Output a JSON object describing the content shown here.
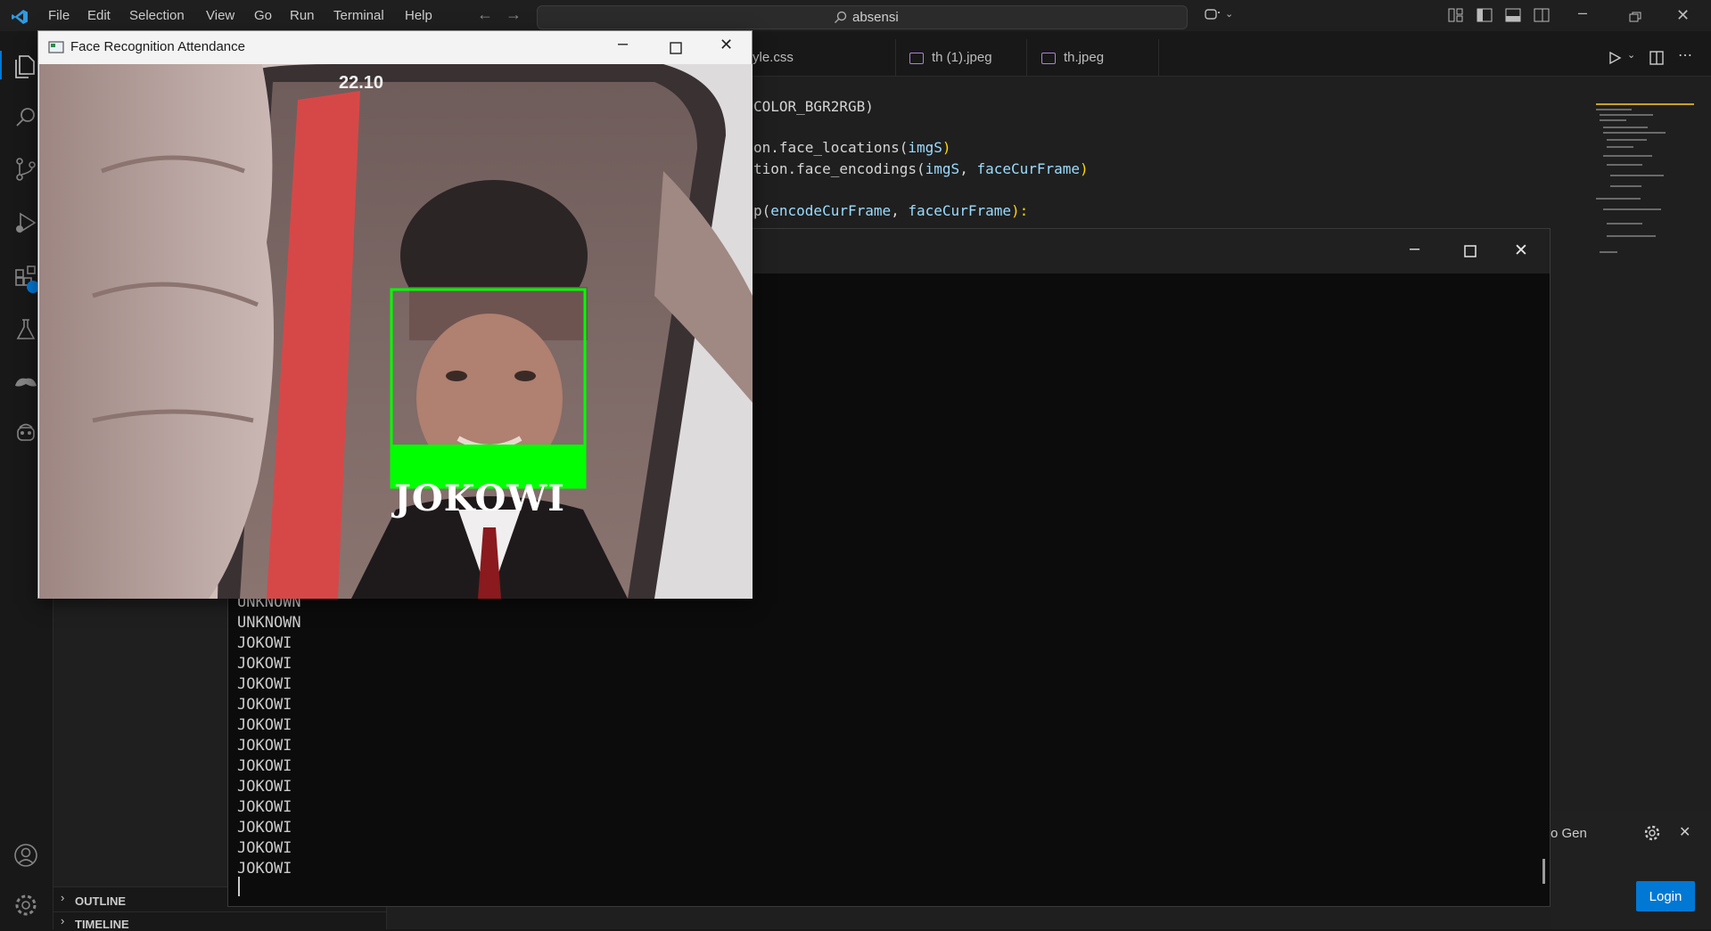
{
  "menu": [
    "File",
    "Edit",
    "Selection",
    "View",
    "Go",
    "Run",
    "Terminal",
    "Help"
  ],
  "command_center": {
    "text": "absensi"
  },
  "tabs": [
    {
      "label": "yle.css"
    },
    {
      "label": "th (1).jpeg"
    },
    {
      "label": "th.jpeg"
    }
  ],
  "code": {
    "line1": "COLOR_BGR2RGB)",
    "line2a": "on.face_locations(",
    "line2b": "imgS",
    "line2c": ")",
    "line3a": "tion.face_encodings(",
    "line3b": "imgS",
    "line3c": ", ",
    "line3d": "faceCurFrame",
    "line3e": ")",
    "line4a": "p(",
    "line4b": "encodeCurFrame",
    "line4c": ", ",
    "line4d": "faceCurFrame",
    "line4e": "):"
  },
  "face_window": {
    "title": "Face Recognition Attendance",
    "overlay_label": "JOKOWI",
    "box_color": "#00ff00",
    "clock_text": "22.10"
  },
  "terminal": {
    "lines": [
      "UNKNOWN",
      "UNKNOWN",
      "JOKOWI",
      "JOKOWI",
      "JOKOWI",
      "JOKOWI",
      "JOKOWI",
      "JOKOWI",
      "JOKOWI",
      "JOKOWI",
      "JOKOWI",
      "JOKOWI",
      "JOKOWI",
      "JOKOWI"
    ]
  },
  "sidebar": {
    "outline": "OUTLINE",
    "timeline": "TIMELINE"
  },
  "notification": {
    "text": "o Gen",
    "button": "Login"
  },
  "colors": {
    "accent": "#0078d4",
    "detect_box": "#00ff00",
    "bracket": "#ffd700"
  }
}
